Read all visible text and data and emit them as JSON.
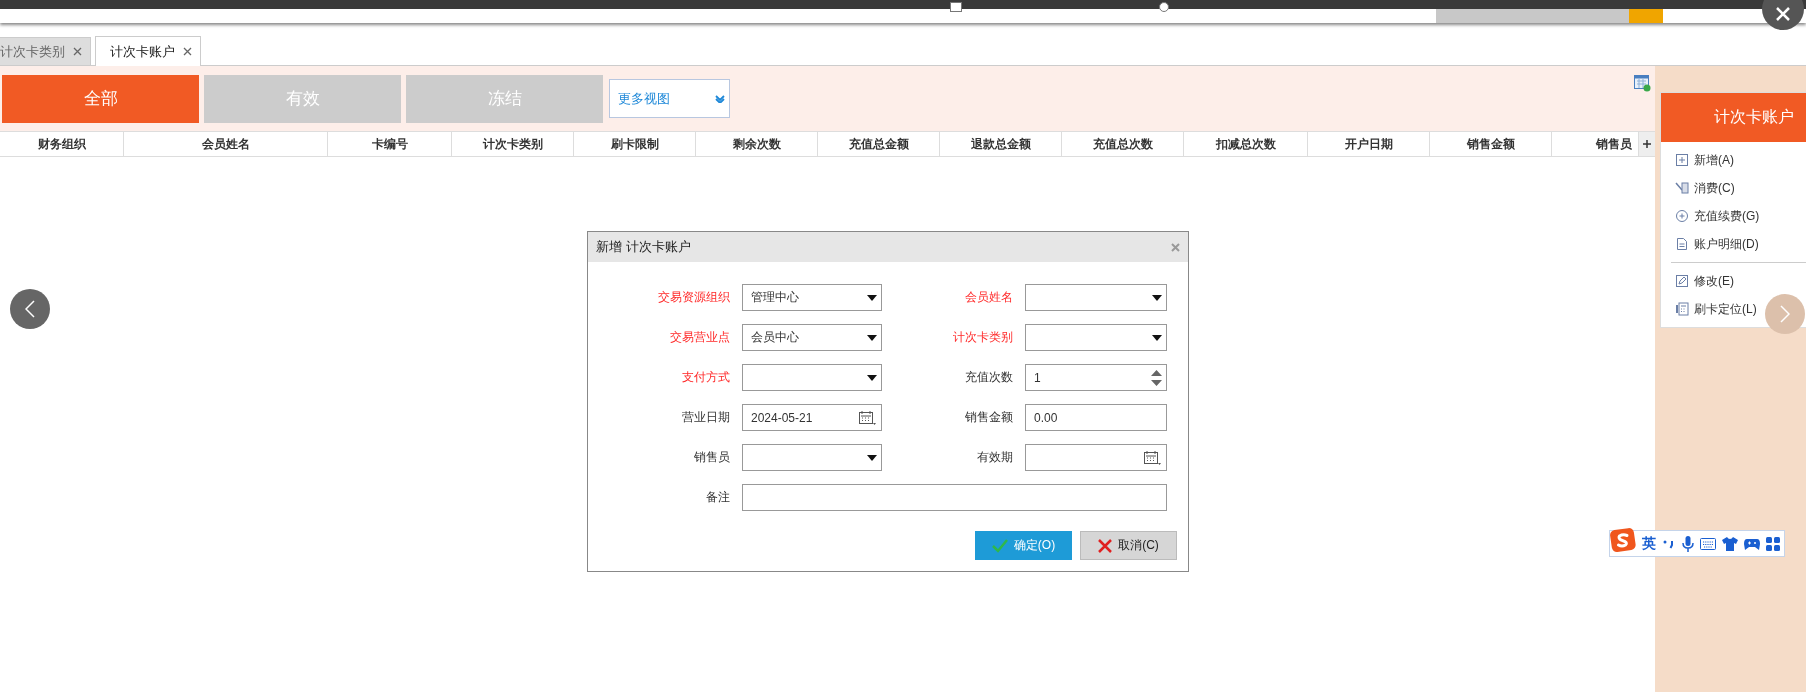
{
  "tabs": [
    {
      "label": "计次卡类别",
      "selected": false
    },
    {
      "label": "计次卡账户",
      "selected": true
    }
  ],
  "filters": [
    {
      "label": "全部",
      "selected": true
    },
    {
      "label": "有效",
      "selected": false
    },
    {
      "label": "冻结",
      "selected": false
    }
  ],
  "view_select": {
    "value": "更多视图"
  },
  "table": {
    "columns": [
      "财务组织",
      "会员姓名",
      "卡编号",
      "计次卡类别",
      "刷卡限制",
      "剩余次数",
      "充值总金额",
      "退款总金额",
      "充值总次数",
      "扣减总次数",
      "开户日期",
      "销售金额",
      "销售员"
    ]
  },
  "dialog": {
    "title": "新增 计次卡账户",
    "fields": [
      {
        "label": "交易资源组织",
        "required": true,
        "kind": "select",
        "value": "管理中心"
      },
      {
        "label": "会员姓名",
        "required": true,
        "kind": "select"
      },
      {
        "label": "交易营业点",
        "required": true,
        "kind": "select",
        "value": "会员中心"
      },
      {
        "label": "计次卡类别",
        "required": true,
        "kind": "select"
      },
      {
        "label": "支付方式",
        "required": true,
        "kind": "select"
      },
      {
        "label": "充值次数",
        "required": false,
        "kind": "number",
        "value": "1"
      },
      {
        "label": "营业日期",
        "required": false,
        "kind": "date",
        "value": "2024-05-21"
      },
      {
        "label": "销售金额",
        "required": false,
        "kind": "text",
        "value": "0.00"
      },
      {
        "label": "销售员",
        "required": false,
        "kind": "select"
      },
      {
        "label": "有效期",
        "required": false,
        "kind": "date"
      },
      {
        "label": "备注",
        "required": false,
        "kind": "wide"
      }
    ],
    "buttons": [
      {
        "label": "确定(O)",
        "kind": "primary"
      },
      {
        "label": "取消(C)",
        "kind": "cancel"
      }
    ]
  },
  "side_panel": {
    "title": "计次卡账户",
    "groups": [
      [
        {
          "label": "新增(A)"
        },
        {
          "label": "消费(C)"
        },
        {
          "label": "充值续费(G)"
        },
        {
          "label": "账户明细(D)"
        }
      ],
      [
        {
          "label": "修改(E)"
        },
        {
          "label": "刷卡定位(L)"
        }
      ]
    ]
  },
  "ime": {
    "mode": "英"
  }
}
